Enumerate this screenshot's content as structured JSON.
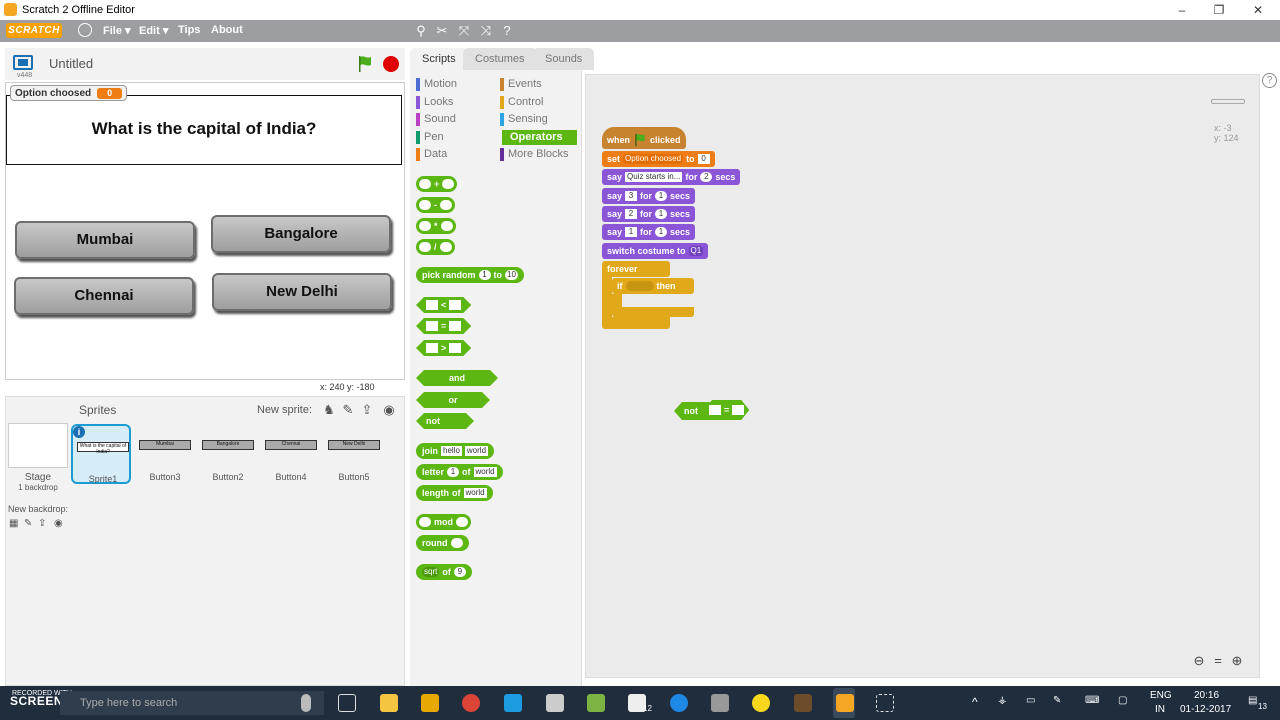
{
  "window": {
    "title": "Scratch 2 Offline Editor",
    "minimize": "–",
    "maximize": "❐",
    "close": "✕"
  },
  "menubar": {
    "logo": "SCRATCH",
    "file": "File ▾",
    "edit": "Edit ▾",
    "tips": "Tips",
    "about": "About"
  },
  "stage_header": {
    "project_name": "Untitled",
    "version": "v448"
  },
  "stage": {
    "monitor": {
      "label": "Option choosed",
      "value": "0"
    },
    "question": "What is the capital of India?",
    "answers": [
      "Mumbai",
      "Bangalore",
      "Chennai",
      "New Delhi"
    ],
    "coords": "x: 240   y: -180"
  },
  "sprites": {
    "title": "Sprites",
    "new_sprite": "New sprite:",
    "stage_label": "Stage",
    "stage_sub": "1 backdrop",
    "new_backdrop": "New backdrop:",
    "items": [
      {
        "name": "Sprite1",
        "thumb": "What is the capital of India?"
      },
      {
        "name": "Button3",
        "thumb": "Mumbai"
      },
      {
        "name": "Button2",
        "thumb": "Bangalore"
      },
      {
        "name": "Button4",
        "thumb": "Chennai"
      },
      {
        "name": "Button5",
        "thumb": "New Delhi"
      }
    ]
  },
  "tabs": {
    "scripts": "Scripts",
    "costumes": "Costumes",
    "sounds": "Sounds"
  },
  "categories": {
    "motion": "Motion",
    "looks": "Looks",
    "sound": "Sound",
    "pen": "Pen",
    "data": "Data",
    "events": "Events",
    "control": "Control",
    "sensing": "Sensing",
    "operators": "Operators",
    "more": "More Blocks"
  },
  "palette": {
    "plus": "+",
    "minus": "-",
    "times": "*",
    "divide": "/",
    "pick_random": "pick random",
    "pr_a": "1",
    "to": "to",
    "pr_b": "10",
    "lt": "<",
    "eq": "=",
    "gt": ">",
    "and": "and",
    "or": "or",
    "not": "not",
    "join": "join",
    "hello": "hello",
    "world": "world",
    "letter": "letter",
    "letter_n": "1",
    "of": "of",
    "length": "length",
    "mod": "mod",
    "round": "round",
    "sqrt": "sqrt",
    "sqrt_n": "9"
  },
  "script": {
    "when": "when",
    "clicked": "clicked",
    "set": "set",
    "var": "Option choosed",
    "to": "to",
    "set_val": "0",
    "say": "say",
    "say_text": "Quiz starts in...",
    "for": "for",
    "secs": "secs",
    "n2": "2",
    "n3": "3",
    "n1": "1",
    "switch": "switch costume to",
    "costume": "Q1",
    "forever": "forever",
    "if": "if",
    "then": "then",
    "not": "not",
    "eq": "=",
    "x_readout": "x: -3",
    "y_readout": "y: 124"
  },
  "taskbar": {
    "search": "Type here to search",
    "recorded": "RECORDED WITH",
    "brand": "SCREENCAST-O-MATIC",
    "lang1": "ENG",
    "lang2": "IN",
    "time": "20:16",
    "date": "01-12-2017",
    "badge": "12",
    "notif": "13"
  }
}
